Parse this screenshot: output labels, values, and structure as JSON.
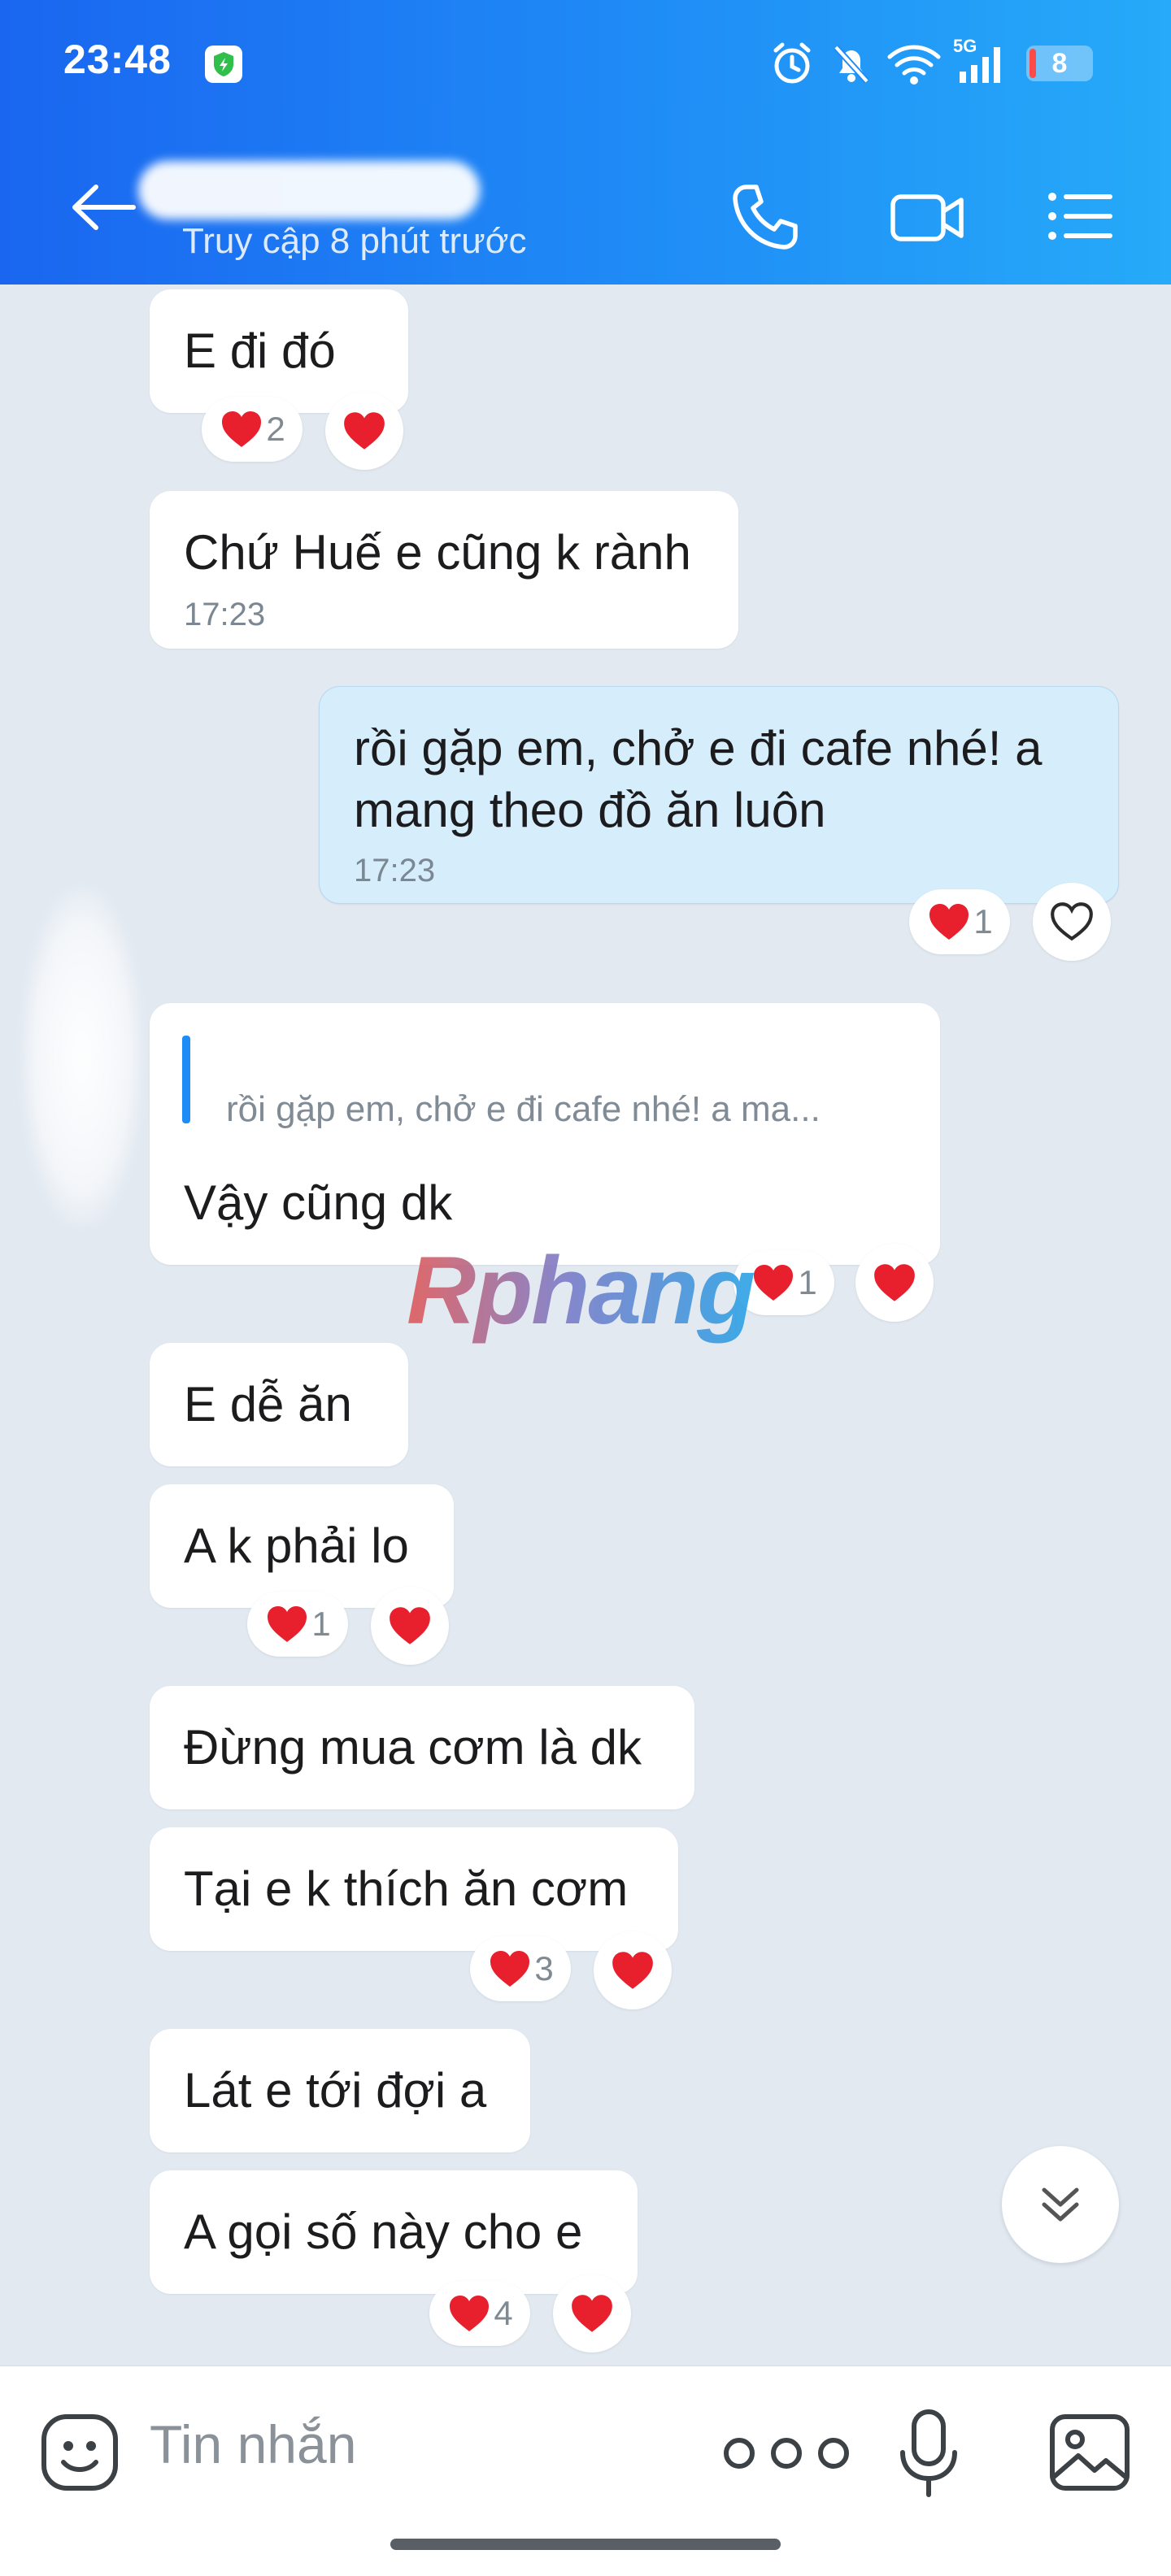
{
  "status_bar": {
    "time": "23:48",
    "network": "5G",
    "battery": "8"
  },
  "header": {
    "subtitle": "Truy cập 8 phút trước"
  },
  "messages": [
    {
      "text": "E đi đó"
    },
    {
      "text": "Chứ Huế e cũng k rành",
      "time": "17:23"
    },
    {
      "text_line1": "rồi gặp em, chở e đi cafe nhé! a",
      "text_line2": "mang theo đồ ăn luôn",
      "time": "17:23"
    },
    {
      "quote": "rồi gặp em, chở e đi cafe nhé! a ma...",
      "text": "Vậy cũng dk"
    },
    {
      "text": "E dễ ăn"
    },
    {
      "text": "A k phải lo"
    },
    {
      "text": "Đừng mua cơm là dk"
    },
    {
      "text": "Tại e k thích ăn cơm"
    },
    {
      "text": "Lát e tới đợi a"
    },
    {
      "text": "A gọi số này cho e"
    }
  ],
  "reactions": {
    "r1": "2",
    "r3": "1",
    "r4": "1",
    "r6": "1",
    "r8": "3",
    "r10": "4"
  },
  "watermark": "Rphang",
  "input": {
    "placeholder": "Tin nhắn"
  },
  "colors": {
    "header_start": "#1a66f0",
    "header_end": "#26aaf9",
    "sent_bubble": "#d6eefc",
    "heart": "#e8202e",
    "chat_bg": "#e2e9f1"
  }
}
